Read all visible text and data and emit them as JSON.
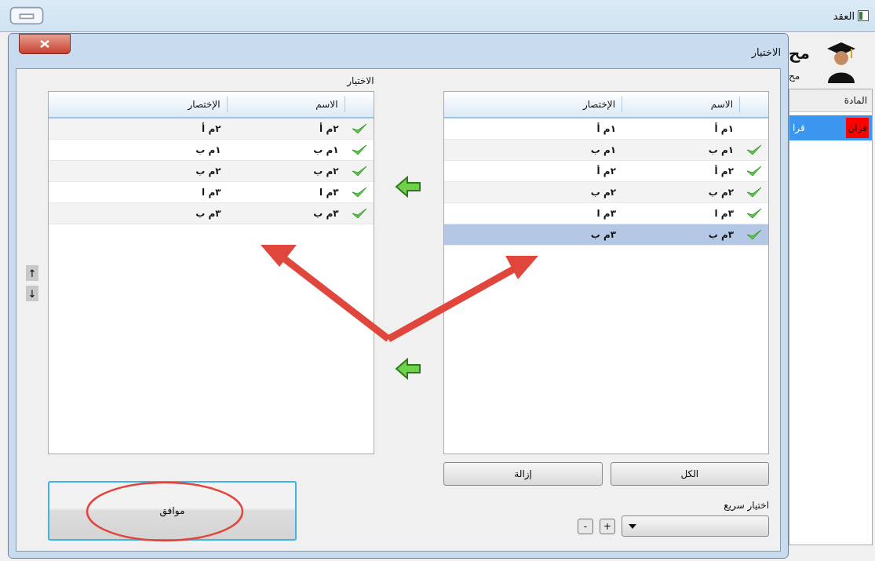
{
  "main_window": {
    "title": "العقد",
    "user_name": "مح",
    "user_detail": "مح",
    "table": {
      "column": "المادة",
      "row": {
        "tag": "قران",
        "text": "قرا",
        "selected": true
      }
    }
  },
  "dialog": {
    "title": "الاختيار",
    "selected_panel": {
      "label": "الاختيار",
      "columns": [
        "الاسم",
        "الإختصار"
      ],
      "rows": [
        {
          "name": "٢م أ",
          "abbreviation": "٢م أ",
          "checked": true,
          "selected": false
        },
        {
          "name": "١م ب",
          "abbreviation": "١م ب",
          "checked": true,
          "selected": false
        },
        {
          "name": "٢م ب",
          "abbreviation": "٢م ب",
          "checked": true,
          "selected": false
        },
        {
          "name": "٣م ا",
          "abbreviation": "٣م ا",
          "checked": true,
          "selected": false
        },
        {
          "name": "٣م ب",
          "abbreviation": "٣م ب",
          "checked": true,
          "selected": false
        }
      ],
      "move_buttons": [
        "↑",
        "↓"
      ],
      "ok_button": "موافق"
    },
    "available_panel": {
      "columns": [
        "الاسم",
        "الإختصار"
      ],
      "rows": [
        {
          "name": "١م أ",
          "abbreviation": "١م أ",
          "checked": false,
          "selected": false
        },
        {
          "name": "١م ب",
          "abbreviation": "١م ب",
          "checked": true,
          "selected": false
        },
        {
          "name": "٢م أ",
          "abbreviation": "٢م أ",
          "checked": true,
          "selected": false
        },
        {
          "name": "٢م ب",
          "abbreviation": "٢م ب",
          "checked": true,
          "selected": false
        },
        {
          "name": "٣م ا",
          "abbreviation": "٣م ا",
          "checked": true,
          "selected": false
        },
        {
          "name": "٣م ب",
          "abbreviation": "٣م ب",
          "checked": true,
          "selected": true
        }
      ],
      "buttons": [
        "الكل",
        "إزالة"
      ],
      "quick_select": {
        "label": "اختيار سريع",
        "add": "+",
        "remove": "-"
      }
    }
  }
}
